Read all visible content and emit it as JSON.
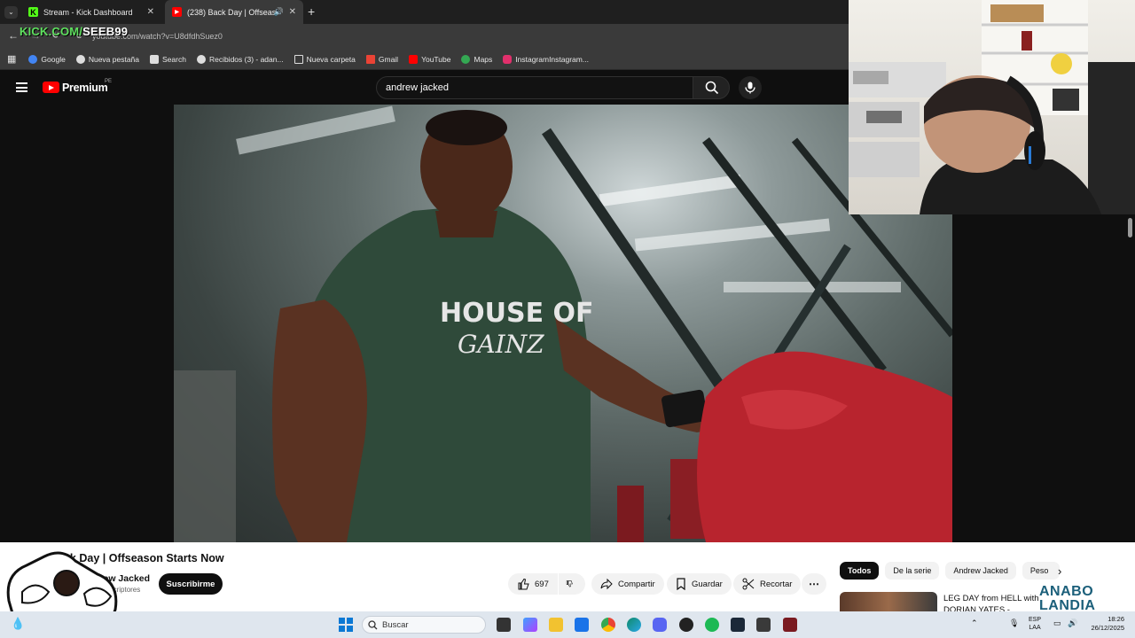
{
  "browser": {
    "tabs": [
      {
        "label": "Stream - Kick Dashboard",
        "icon": "kick-icon"
      },
      {
        "label": "(238) Back Day | Offseason",
        "icon": "youtube-icon",
        "audio": true
      }
    ],
    "url": "youtube.com/watch?v=U8dfdhSuez0",
    "bookmarks": [
      {
        "label": "Google",
        "color": "#4285f4"
      },
      {
        "label": "Nueva pestaña",
        "color": "#dddddd"
      },
      {
        "label": "Search",
        "color": "#dddddd"
      },
      {
        "label": "Recibidos (3) - adan...",
        "color": "#dddddd"
      },
      {
        "label": "Nueva carpeta",
        "color": "#dddddd"
      },
      {
        "label": "Gmail",
        "color": "#ea4335"
      },
      {
        "label": "YouTube",
        "color": "#ff0000"
      },
      {
        "label": "Maps",
        "color": "#34a853"
      },
      {
        "label": "InstagramInstagram...",
        "color": "#e1306c"
      }
    ]
  },
  "overlay": {
    "kick_prefix": "KICK.COM/",
    "kick_user": "SEEB99",
    "brand_line1": "ANABO",
    "brand_line2": "LANDIA"
  },
  "youtube": {
    "logo_text": "Premium",
    "region": "PE",
    "search_value": "andrew jacked",
    "video": {
      "title": "Back Day | Offseason Starts Now",
      "channel": "Andrew Jacked",
      "subscribers": "170 K suscriptores",
      "subscribe_label": "Suscribirme",
      "likes": "697",
      "share_label": "Compartir",
      "save_label": "Guardar",
      "clip_label": "Recortar",
      "shirt_text": "HOUSE OF GAINZ"
    },
    "chips": [
      "Todos",
      "De la serie",
      "Andrew Jacked",
      "Peso"
    ],
    "recommendation": {
      "title": "LEG DAY from HELL with DORIAN YATES - \"TRAINING"
    }
  },
  "taskbar": {
    "search_placeholder": "Buscar",
    "lang_line1": "ESP",
    "lang_line2": "LAA",
    "time": "18:26",
    "date": "26/12/2025"
  },
  "colors": {
    "accent_red": "#ff0000",
    "kick_green": "#53fc18",
    "page_dark": "#0f0f0f"
  }
}
